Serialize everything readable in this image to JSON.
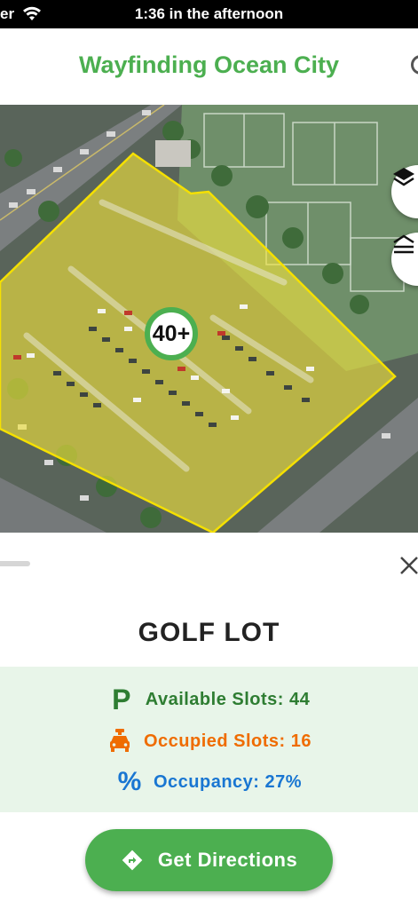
{
  "status_bar": {
    "carrier": "er",
    "time": "1:36 in the afternoon"
  },
  "header": {
    "title": "Wayfinding Ocean City"
  },
  "map": {
    "lot_count_badge": "40+",
    "lot_highlight_color": "#f5e642",
    "badge_ring_color": "#4caf50",
    "buttons": {
      "layers": "layers-icon",
      "floors": "floors-icon"
    }
  },
  "sheet": {
    "lot_name": "GOLF LOT",
    "stats": {
      "available": "Available Slots: 44",
      "occupied": "Occupied Slots: 16",
      "occupancy": "Occupancy: 27%"
    },
    "stat_colors": {
      "available": "#2e7d32",
      "occupied": "#ef6c00",
      "occupancy": "#1976d2"
    },
    "primary_button": "Get Directions",
    "accent_color": "#4caf50",
    "panel_background": "#e8f5e9"
  }
}
